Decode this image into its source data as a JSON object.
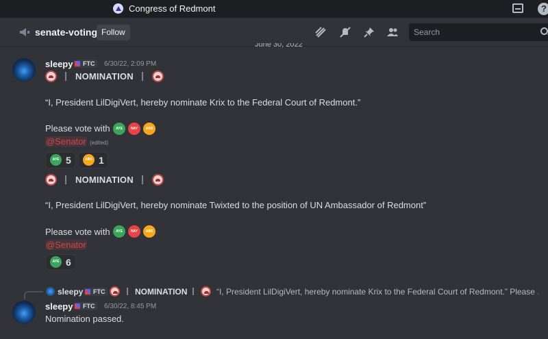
{
  "window": {
    "server_name": "Congress of Redmont"
  },
  "header": {
    "channel_name": "senate-voting",
    "follow_label": "Follow",
    "search_placeholder": "Search"
  },
  "date_divider": "June 30, 2022",
  "messages": [
    {
      "author": "sleepy",
      "tag": "FTC",
      "timestamp": "6/30/22, 2:09 PM",
      "nomination_label": "NOMINATION",
      "quote": "“I, President LilDigiVert, hereby nominate Krix to the Federal Court of Redmont.”",
      "vote_prompt": "Please vote with",
      "vote_icons": [
        "AYE",
        "NAY",
        "ABS"
      ],
      "mention": "@Senator",
      "edited": "(edited)",
      "reactions": [
        {
          "emoji": "AYE",
          "count": "5"
        },
        {
          "emoji": "ABS",
          "count": "1"
        }
      ]
    },
    {
      "nomination_label": "NOMINATION",
      "quote": "“I, President LilDigiVert, hereby nominate Twixted to the position of UN Ambassador of Redmont”",
      "vote_prompt": "Please vote with",
      "vote_icons": [
        "AYE",
        "NAY",
        "ABS"
      ],
      "mention": "@Senator",
      "reactions": [
        {
          "emoji": "AYE",
          "count": "6"
        }
      ]
    },
    {
      "reply": {
        "author": "sleepy",
        "tag": "FTC",
        "nomination_label": "NOMINATION",
        "preview": "“I, President LilDigiVert, hereby nominate Krix to the Federal Court of Redmont.”  Please ..."
      },
      "author": "sleepy",
      "tag": "FTC",
      "timestamp": "6/30/22, 8:45 PM",
      "content": "Nomination passed."
    }
  ],
  "colors": {
    "aye": "#3ba55c",
    "nay": "#ed4245",
    "abs": "#faa61a",
    "mention": "#c9494b"
  }
}
